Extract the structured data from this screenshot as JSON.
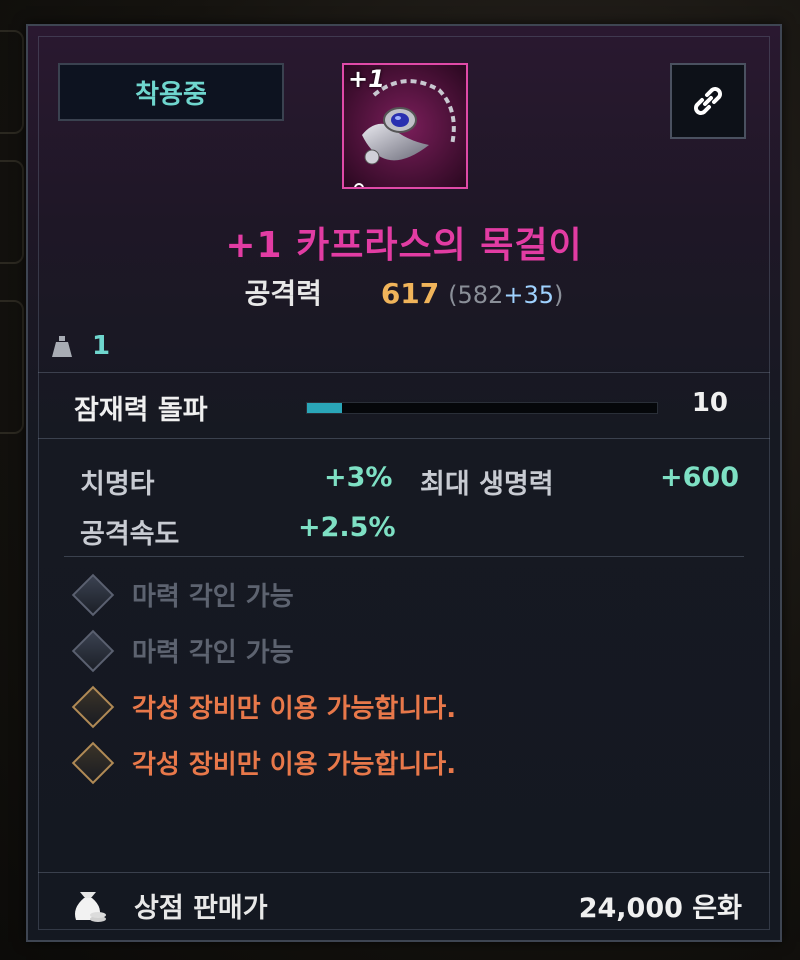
{
  "status": {
    "equipped_label": "착용중"
  },
  "item": {
    "upgrade_level": "+1",
    "name": "+1 카프라스의 목걸이",
    "rarity_color": "#e23ca3"
  },
  "attack": {
    "label": "공격력",
    "value": "617",
    "base": "(582",
    "bonus": "+35",
    "close": ")"
  },
  "weight": {
    "icon": "weight-icon",
    "value": "1"
  },
  "potential": {
    "label": "잠재력 돌파",
    "value": "10",
    "progress_fraction": 0.1
  },
  "stats": [
    {
      "label": "치명타",
      "value": "+3%"
    },
    {
      "label": "최대 생명력",
      "value": "+600"
    },
    {
      "label": "공격속도",
      "value": "+2.5%"
    }
  ],
  "notices": [
    {
      "text": "마력 각인 가능",
      "style": "gray"
    },
    {
      "text": "마력 각인 가능",
      "style": "gray"
    },
    {
      "text": "각성 장비만 이용 가능합니다.",
      "style": "orange"
    },
    {
      "text": "각성 장비만 이용 가능합니다.",
      "style": "orange"
    }
  ],
  "shop": {
    "label": "상점 판매가",
    "value": "24,000 은화"
  },
  "colors": {
    "accent_teal": "#6fd6ce",
    "attack_gold": "#f0b45a",
    "stat_green": "#7ee0c4",
    "warning_orange": "#e8784a"
  }
}
